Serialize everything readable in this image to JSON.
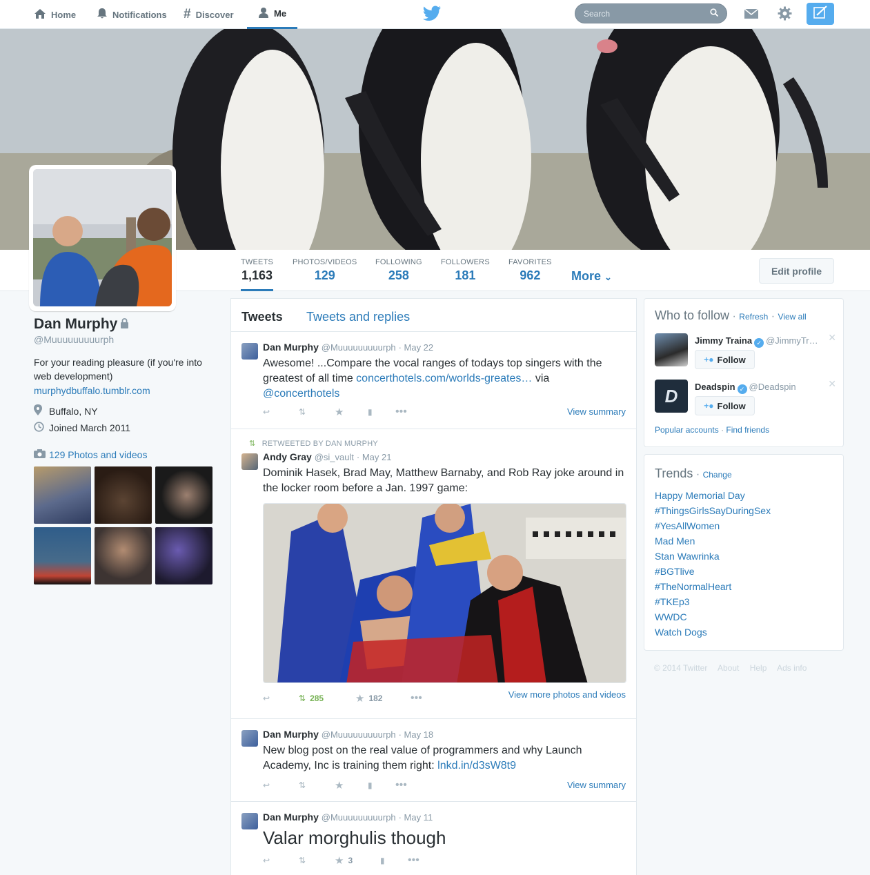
{
  "nav": {
    "home": "Home",
    "notifications": "Notifications",
    "discover": "Discover",
    "me": "Me",
    "search_placeholder": "Search"
  },
  "profile": {
    "name": "Dan Murphy",
    "handle": "@Muuuuuuuuurph",
    "bio": "For your reading pleasure (if you're into web development)",
    "url": "murphydbuffalo.tumblr.com",
    "location": "Buffalo, NY",
    "joined": "Joined March 2011",
    "photos_link": "129 Photos and videos",
    "edit_button": "Edit profile"
  },
  "stats": [
    {
      "label": "TWEETS",
      "value": "1,163"
    },
    {
      "label": "PHOTOS/VIDEOS",
      "value": "129"
    },
    {
      "label": "FOLLOWING",
      "value": "258"
    },
    {
      "label": "FOLLOWERS",
      "value": "181"
    },
    {
      "label": "FAVORITES",
      "value": "962"
    }
  ],
  "more_label": "More",
  "tabs": {
    "tweets": "Tweets",
    "replies": "Tweets and replies"
  },
  "tweets": [
    {
      "name": "Dan Murphy",
      "handle": "@Muuuuuuuuurph",
      "date": "May 22",
      "text_before": "Awesome! ...Compare the vocal ranges of todays top singers with the greatest of all time ",
      "link": "concerthotels.com/worlds-greates…",
      "text_mid": " via ",
      "mention": "@concerthotels",
      "right_link": "View summary"
    },
    {
      "retweeted_by": "RETWEETED BY DAN MURPHY",
      "name": "Andy Gray",
      "handle": "@si_vault",
      "date": "May 21",
      "text": "Dominik Hasek, Brad May, Matthew Barnaby, and Rob Ray joke around in the locker room before a Jan. 1997 game:",
      "retweets": "285",
      "favorites": "182",
      "right_link": "View more photos and videos"
    },
    {
      "name": "Dan Murphy",
      "handle": "@Muuuuuuuuurph",
      "date": "May 18",
      "text": "New blog post on the real value of programmers and why Launch Academy, Inc is training them right: ",
      "link": "lnkd.in/d3sW8t9",
      "right_link": "View summary"
    },
    {
      "name": "Dan Murphy",
      "handle": "@Muuuuuuuuurph",
      "date": "May 11",
      "text": "Valar morghulis though",
      "favorites": "3"
    }
  ],
  "who_to_follow": {
    "title": "Who to follow",
    "refresh": "Refresh",
    "view_all": "View all",
    "users": [
      {
        "name": "Jimmy Traina",
        "handle": "@JimmyTr…",
        "button": "Follow"
      },
      {
        "name": "Deadspin",
        "handle": "@Deadspin",
        "button": "Follow"
      }
    ],
    "popular": "Popular accounts",
    "find_friends": "Find friends"
  },
  "trends": {
    "title": "Trends",
    "change": "Change",
    "items": [
      "Happy Memorial Day",
      "#ThingsGirlsSayDuringSex",
      "#YesAllWomen",
      "Mad Men",
      "Stan Wawrinka",
      "#BGTlive",
      "#TheNormalHeart",
      "#TKEp3",
      "WWDC",
      "Watch Dogs"
    ]
  },
  "footer": {
    "copyright": "© 2014 Twitter",
    "about": "About",
    "help": "Help",
    "ads": "Ads info"
  },
  "colors": {
    "accent": "#2b7bb9",
    "retweet_green": "#77b255",
    "tweet_button": "#55acee"
  }
}
